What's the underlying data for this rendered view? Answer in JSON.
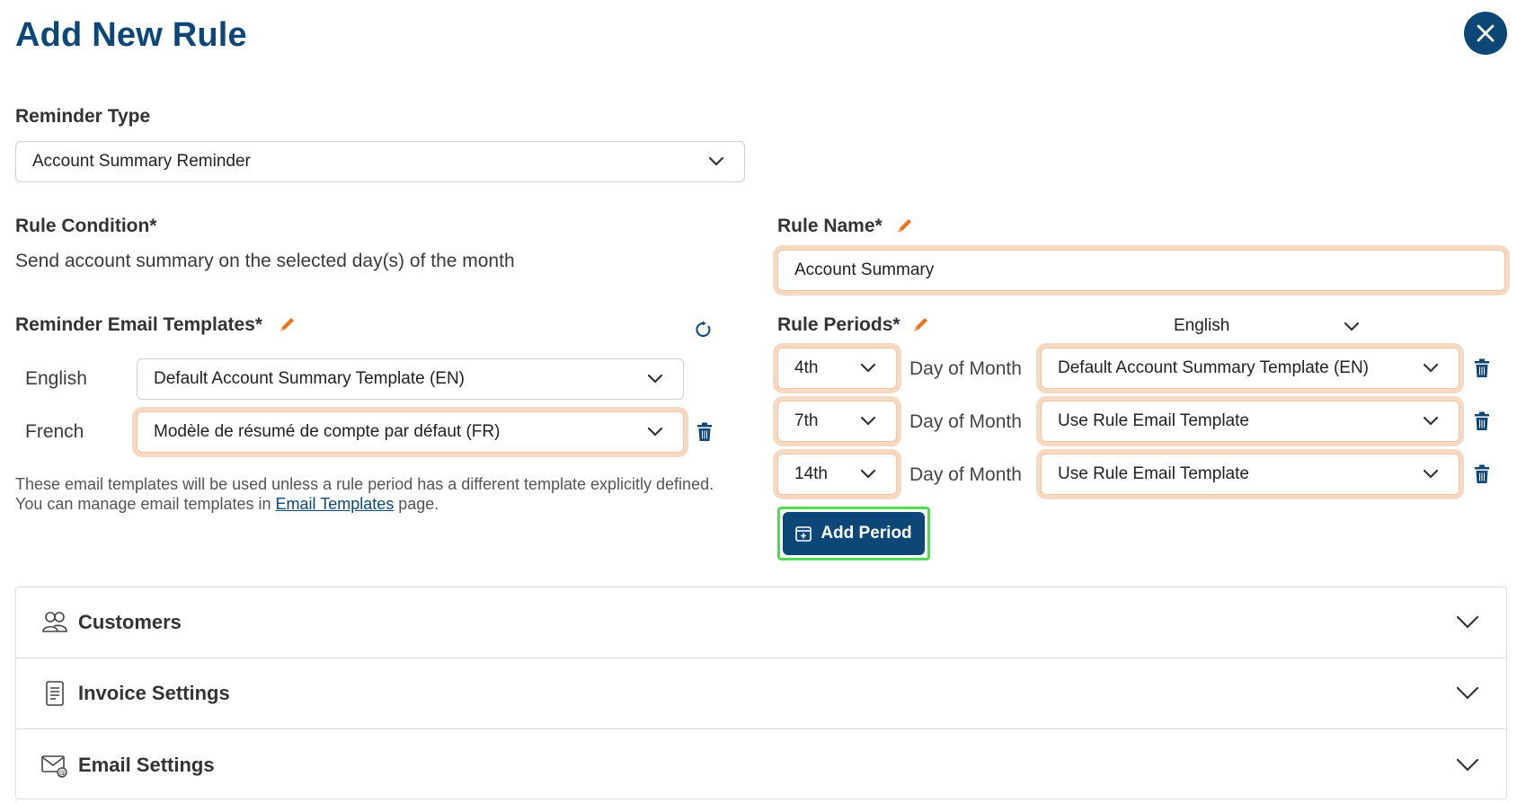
{
  "dialog": {
    "title": "Add New Rule"
  },
  "reminder_type": {
    "label": "Reminder Type",
    "value": "Account Summary Reminder"
  },
  "rule_condition": {
    "label": "Rule Condition*",
    "text": "Send account summary on the selected day(s) of the month"
  },
  "rule_name": {
    "label": "Rule Name*",
    "value": "Account Summary"
  },
  "templates": {
    "label": "Reminder Email Templates*",
    "rows": [
      {
        "language": "English",
        "value": "Default Account Summary Template (EN)"
      },
      {
        "language": "French",
        "value": "Modèle de résumé de compte par défaut (FR)"
      }
    ],
    "note_before": "These email templates will be used unless a rule period has a different template explicitly defined. You can manage email templates in ",
    "note_link": "Email Templates",
    "note_after": " page."
  },
  "rule_periods": {
    "label": "Rule Periods*",
    "language": "English",
    "day_label": "Day of Month",
    "rows": [
      {
        "day": "4th",
        "template": "Default Account Summary Template (EN)"
      },
      {
        "day": "7th",
        "template": "Use Rule Email Template"
      },
      {
        "day": "14th",
        "template": "Use Rule Email Template"
      }
    ],
    "add_label": "Add Period"
  },
  "sections": [
    {
      "label": "Customers",
      "icon": "users-icon"
    },
    {
      "label": "Invoice Settings",
      "icon": "document-icon"
    },
    {
      "label": "Email Settings",
      "icon": "email-icon"
    }
  ],
  "colors": {
    "brand": "#0d4778",
    "highlight": "#f6d9c2",
    "pencil": "#e8731a",
    "focus_green": "#55d855"
  }
}
